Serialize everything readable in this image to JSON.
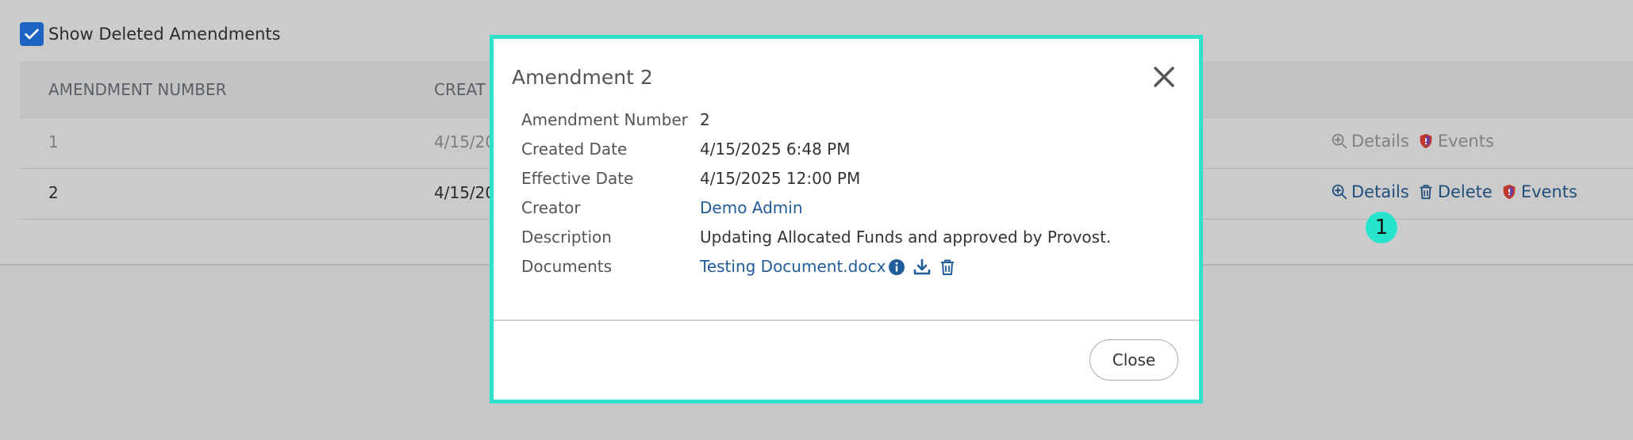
{
  "filter": {
    "show_deleted_label": "Show Deleted Amendments",
    "checked": true
  },
  "table": {
    "headers": [
      "AMENDMENT NUMBER",
      "CREAT"
    ],
    "rows": [
      {
        "number": "1",
        "created": "4/15/20",
        "deleted": true,
        "actions": {
          "details": "Details",
          "events": "Events"
        }
      },
      {
        "number": "2",
        "created": "4/15/20",
        "deleted": false,
        "actions": {
          "details": "Details",
          "delete": "Delete",
          "events": "Events"
        }
      }
    ]
  },
  "step_badge": "1",
  "modal": {
    "title": "Amendment 2",
    "fields": {
      "number_label": "Amendment Number",
      "number": "2",
      "created_label": "Created Date",
      "created": "4/15/2025 6:48 PM",
      "effective_label": "Effective Date",
      "effective": "4/15/2025 12:00 PM",
      "creator_label": "Creator",
      "creator": "Demo Admin",
      "description_label": "Description",
      "description": "Updating Allocated Funds and approved by Provost.",
      "documents_label": "Documents",
      "document": "Testing Document.docx"
    },
    "close_button": "Close"
  },
  "colors": {
    "accent": "#2fe0cc",
    "link": "#1f5c99",
    "checkbox": "#1d63c2",
    "shield": "#c0392b"
  }
}
